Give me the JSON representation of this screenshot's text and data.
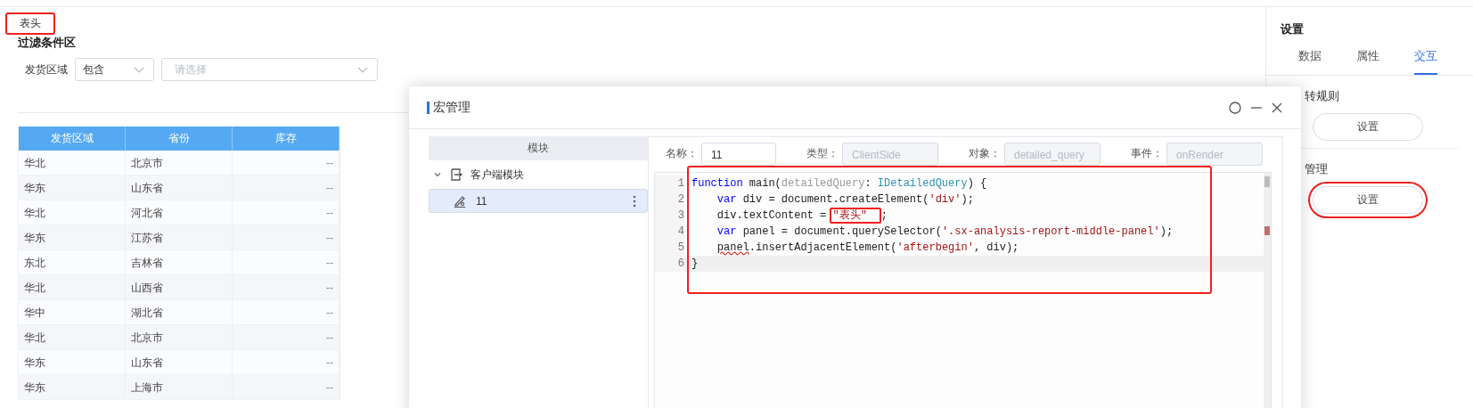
{
  "header_text": {
    "text": "表头",
    "highlighted": true
  },
  "filter_area": {
    "title": "过滤条件区",
    "label": "发货区域",
    "operator": "包含",
    "placeholder": "请选择"
  },
  "table": {
    "columns": [
      "发货区域",
      "省份",
      "库存"
    ],
    "rows": [
      [
        "华北",
        "北京市",
        "--"
      ],
      [
        "华东",
        "山东省",
        "--"
      ],
      [
        "华北",
        "河北省",
        "--"
      ],
      [
        "华东",
        "江苏省",
        "--"
      ],
      [
        "东北",
        "吉林省",
        "--"
      ],
      [
        "华北",
        "山西省",
        "--"
      ],
      [
        "华中",
        "湖北省",
        "--"
      ],
      [
        "华北",
        "北京市",
        "--"
      ],
      [
        "华东",
        "山东省",
        "--"
      ],
      [
        "华东",
        "上海市",
        "--"
      ]
    ]
  },
  "settings_panel": {
    "title": "设置",
    "tabs": [
      {
        "label": "数据",
        "selected": false
      },
      {
        "label": "属性",
        "selected": false
      },
      {
        "label": "交互",
        "selected": true
      }
    ],
    "sections": [
      {
        "label": "转规则",
        "button": "设置",
        "highlighted": false
      },
      {
        "label": "管理",
        "button": "设置",
        "highlighted": true
      }
    ]
  },
  "dialog": {
    "title": "宏管理",
    "module_header": "模块",
    "tree": [
      {
        "label": "客户端模块",
        "expanded": true,
        "children": [
          {
            "label": "11",
            "selected": true
          }
        ]
      }
    ],
    "fields": [
      {
        "label": "名称：",
        "value": "11",
        "disabled": false
      },
      {
        "label": "类型：",
        "value": "ClientSide",
        "disabled": true
      },
      {
        "label": "对象：",
        "value": "detailed_query",
        "disabled": true
      },
      {
        "label": "事件：",
        "value": "onRender",
        "disabled": true
      }
    ],
    "editor": {
      "highlighted": true,
      "lines": [
        {
          "number": "1",
          "current": false,
          "tokens": [
            {
              "kind": "keyword",
              "text": "function"
            },
            {
              "kind": "plain",
              "text": " main("
            },
            {
              "kind": "param",
              "text": "detailedQuery"
            },
            {
              "kind": "plain",
              "text": ": "
            },
            {
              "kind": "type",
              "text": "IDetailedQuery"
            },
            {
              "kind": "plain",
              "text": ") {"
            }
          ]
        },
        {
          "number": "2",
          "current": false,
          "tokens": [
            {
              "kind": "keyword",
              "text": "    var"
            },
            {
              "kind": "plain",
              "text": " div = document.createElement("
            },
            {
              "kind": "string",
              "text": "'div'"
            },
            {
              "kind": "plain",
              "text": ");"
            }
          ]
        },
        {
          "number": "3",
          "current": false,
          "tokens": [
            {
              "kind": "plain",
              "text": "    div.textContent = "
            },
            {
              "kind": "string",
              "text": "\"表头\"",
              "boxed": true
            },
            {
              "kind": "plain",
              "text": ";"
            }
          ]
        },
        {
          "number": "4",
          "current": false,
          "tokens": [
            {
              "kind": "keyword",
              "text": "    var"
            },
            {
              "kind": "plain",
              "text": " panel = document.querySelector("
            },
            {
              "kind": "string",
              "text": "'.sx-analysis-report-middle-panel'"
            },
            {
              "kind": "plain",
              "text": ");"
            }
          ]
        },
        {
          "number": "5",
          "current": false,
          "tokens": [
            {
              "kind": "plain",
              "text": "    panel",
              "error": true
            },
            {
              "kind": "plain",
              "text": ".insertAdjacentElement("
            },
            {
              "kind": "string",
              "text": "'afterbegin'"
            },
            {
              "kind": "plain",
              "text": ", div);"
            }
          ]
        },
        {
          "number": "6",
          "current": true,
          "tokens": [
            {
              "kind": "plain",
              "text": "}"
            }
          ]
        }
      ]
    }
  }
}
